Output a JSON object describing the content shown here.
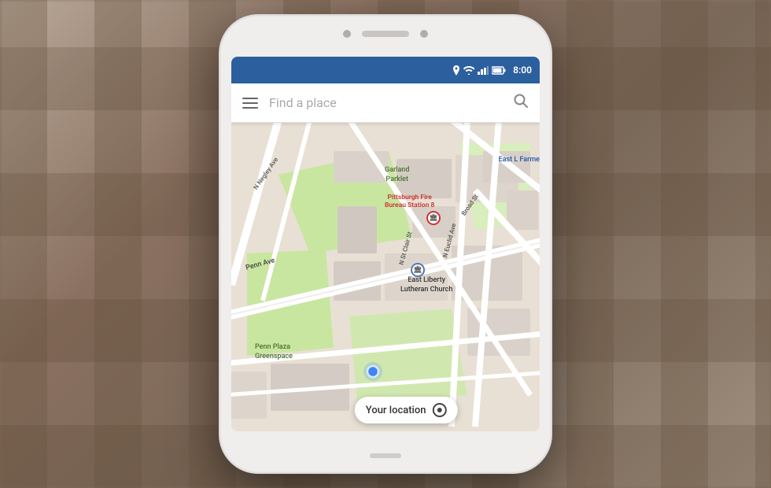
{
  "background": {
    "color": "#8a7060"
  },
  "phone": {
    "status_bar": {
      "time": "8:00",
      "color": "#2c5f9e"
    },
    "search_bar": {
      "placeholder": "Find a place",
      "hamburger_label": "Menu"
    },
    "map": {
      "poi_fire_label": "Pittsburgh Fire\nBureau Station 8",
      "poi_church_label": "East Liberty\nLutheran Church",
      "park1_label": "Garland\nParklet",
      "park2_label": "Penn Plaza\nGreenspace",
      "street1": "N Negley Ave",
      "street2": "Penn Ave",
      "street3": "N St Clair St",
      "street4": "N Euclid Ave",
      "street5": "Broad St",
      "street6": "Broad",
      "east_label": "East L\nFarme",
      "your_location": "Your location"
    }
  }
}
